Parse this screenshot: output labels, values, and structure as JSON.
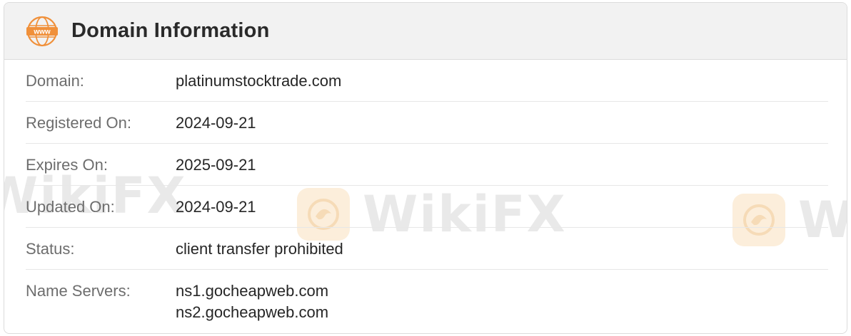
{
  "header": {
    "icon": "www-globe-icon",
    "icon_text": "www",
    "title": "Domain Information"
  },
  "rows": [
    {
      "label": "Domain:",
      "value": "platinumstocktrade.com"
    },
    {
      "label": "Registered On:",
      "value": "2024-09-21"
    },
    {
      "label": "Expires On:",
      "value": "2025-09-21"
    },
    {
      "label": "Updated On:",
      "value": "2024-09-21"
    },
    {
      "label": "Status:",
      "value": "client transfer prohibited"
    },
    {
      "label": "Name Servers:",
      "values": [
        "ns1.gocheapweb.com",
        "ns2.gocheapweb.com"
      ]
    }
  ],
  "watermark": {
    "text": "WikiFX"
  },
  "colors": {
    "accent": "#f0903a",
    "header_bg": "#f2f2f2",
    "label": "#6d6d6d",
    "value": "#262626"
  }
}
